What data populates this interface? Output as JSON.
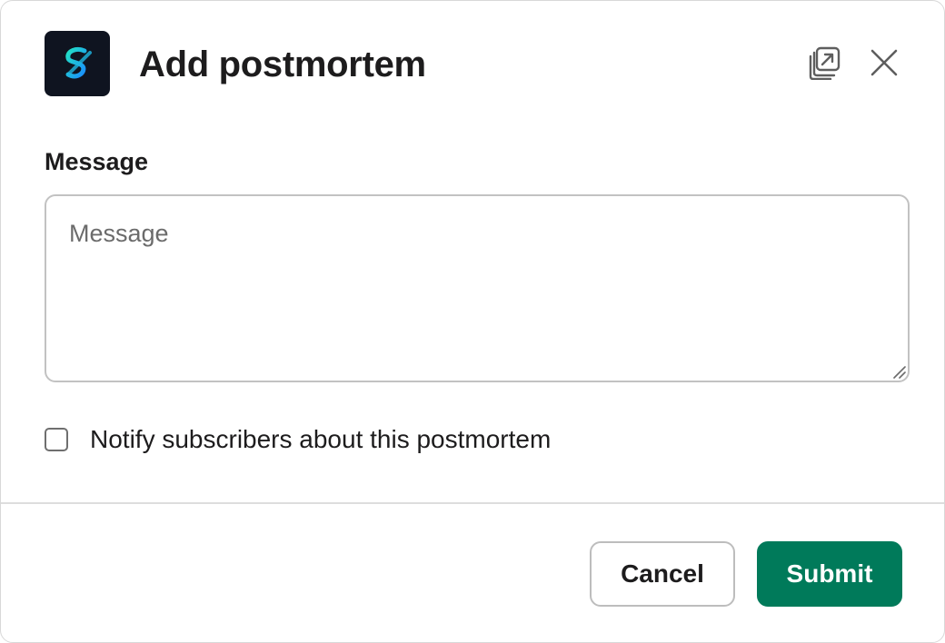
{
  "modal": {
    "title": "Add postmortem",
    "app_icon": "squiggle-logo-icon",
    "header_icons": [
      "popout-icon",
      "close-icon"
    ]
  },
  "form": {
    "message_label": "Message",
    "message_placeholder": "Message",
    "message_value": "",
    "notify_label": "Notify subscribers about this postmortem",
    "notify_checked": false
  },
  "footer": {
    "cancel_label": "Cancel",
    "submit_label": "Submit"
  },
  "colors": {
    "submit_bg": "#007a5a",
    "app_icon_bg": "#0f1420",
    "app_icon_accent": "#16d1c5"
  }
}
